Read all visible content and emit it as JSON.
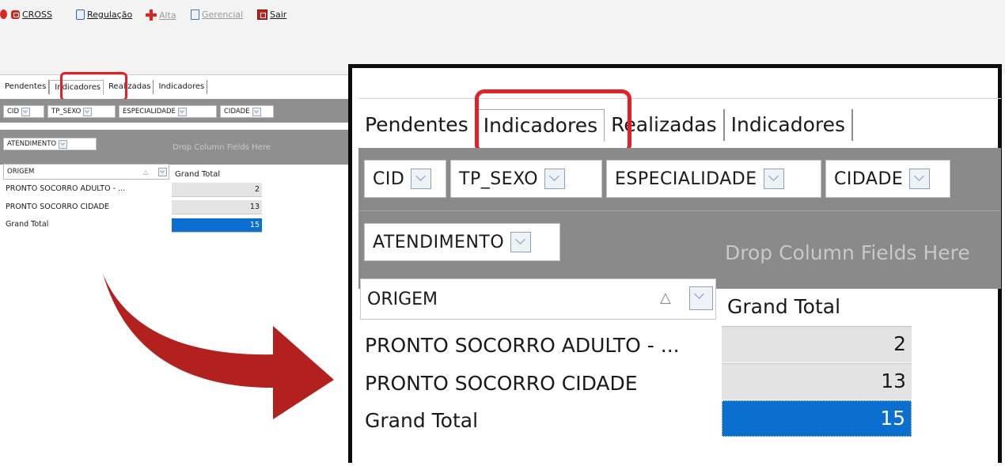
{
  "toolbar": {
    "items": [
      {
        "label": "CROSS",
        "icon": "cross-bag-icon"
      },
      {
        "label": "Regulação",
        "icon": "clipboard-icon"
      },
      {
        "label": "Alta",
        "icon": "red-plus-icon"
      },
      {
        "label": "Gerencial",
        "icon": "document-icon"
      },
      {
        "label": "Sair",
        "icon": "exit-icon"
      }
    ]
  },
  "tabs": [
    "Pendentes",
    "Indicadores",
    "Realizadas",
    "Indicadores"
  ],
  "filter_fields": [
    "CID",
    "TP_SEXO",
    "ESPECIALIDADE",
    "CIDADE"
  ],
  "data_field": "ATENDIMENTO",
  "drop_column_text": "Drop Column Fields Here",
  "row_field": "ORIGEM",
  "sort_icon": "△",
  "grid": {
    "header": "Grand Total",
    "rows": [
      {
        "label": "PRONTO SOCORRO ADULTO - ...",
        "value": "2"
      },
      {
        "label": "PRONTO SOCORRO CIDADE",
        "value": "13"
      },
      {
        "label": "Grand Total",
        "value": "15"
      }
    ]
  },
  "colors": {
    "highlight": "#e0212a",
    "selection": "#0b6fd0",
    "arrow": "#b3211e"
  }
}
